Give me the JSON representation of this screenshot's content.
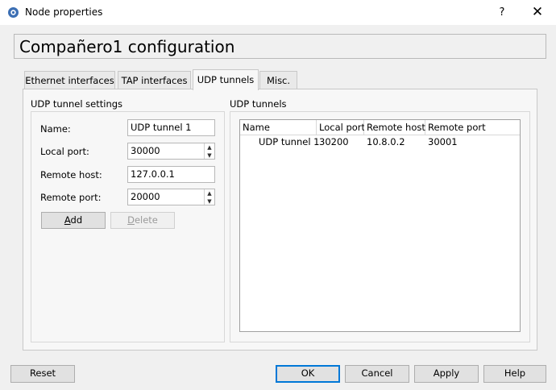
{
  "window": {
    "title": "Node properties",
    "help": "?",
    "close": "✕"
  },
  "header": {
    "title": "Compañero1 configuration"
  },
  "tabs": [
    {
      "label": "Ethernet interfaces",
      "active": false
    },
    {
      "label": "TAP interfaces",
      "active": false
    },
    {
      "label": "UDP tunnels",
      "active": true
    },
    {
      "label": "Misc.",
      "active": false
    }
  ],
  "settings": {
    "group_title": "UDP tunnel settings",
    "name_label": "Name:",
    "name_value": "UDP tunnel 1",
    "local_port_label": "Local port:",
    "local_port_value": "30000",
    "remote_host_label": "Remote host:",
    "remote_host_value": "127.0.0.1",
    "remote_port_label": "Remote port:",
    "remote_port_value": "20000",
    "add_mnemonic": "A",
    "add_rest": "dd",
    "delete_mnemonic": "D",
    "delete_rest": "elete"
  },
  "tunnels": {
    "group_title": "UDP tunnels",
    "columns": [
      "Name",
      "Local port",
      "Remote host",
      "Remote port"
    ],
    "rows": [
      [
        "UDP tunnel 1",
        "30200",
        "10.8.0.2",
        "30001"
      ]
    ]
  },
  "buttons": {
    "reset": "Reset",
    "ok": "OK",
    "cancel": "Cancel",
    "apply": "Apply",
    "help": "Help"
  },
  "colors": {
    "default_button_border": "#0078d7",
    "app_icon": "#3c6fb4"
  }
}
